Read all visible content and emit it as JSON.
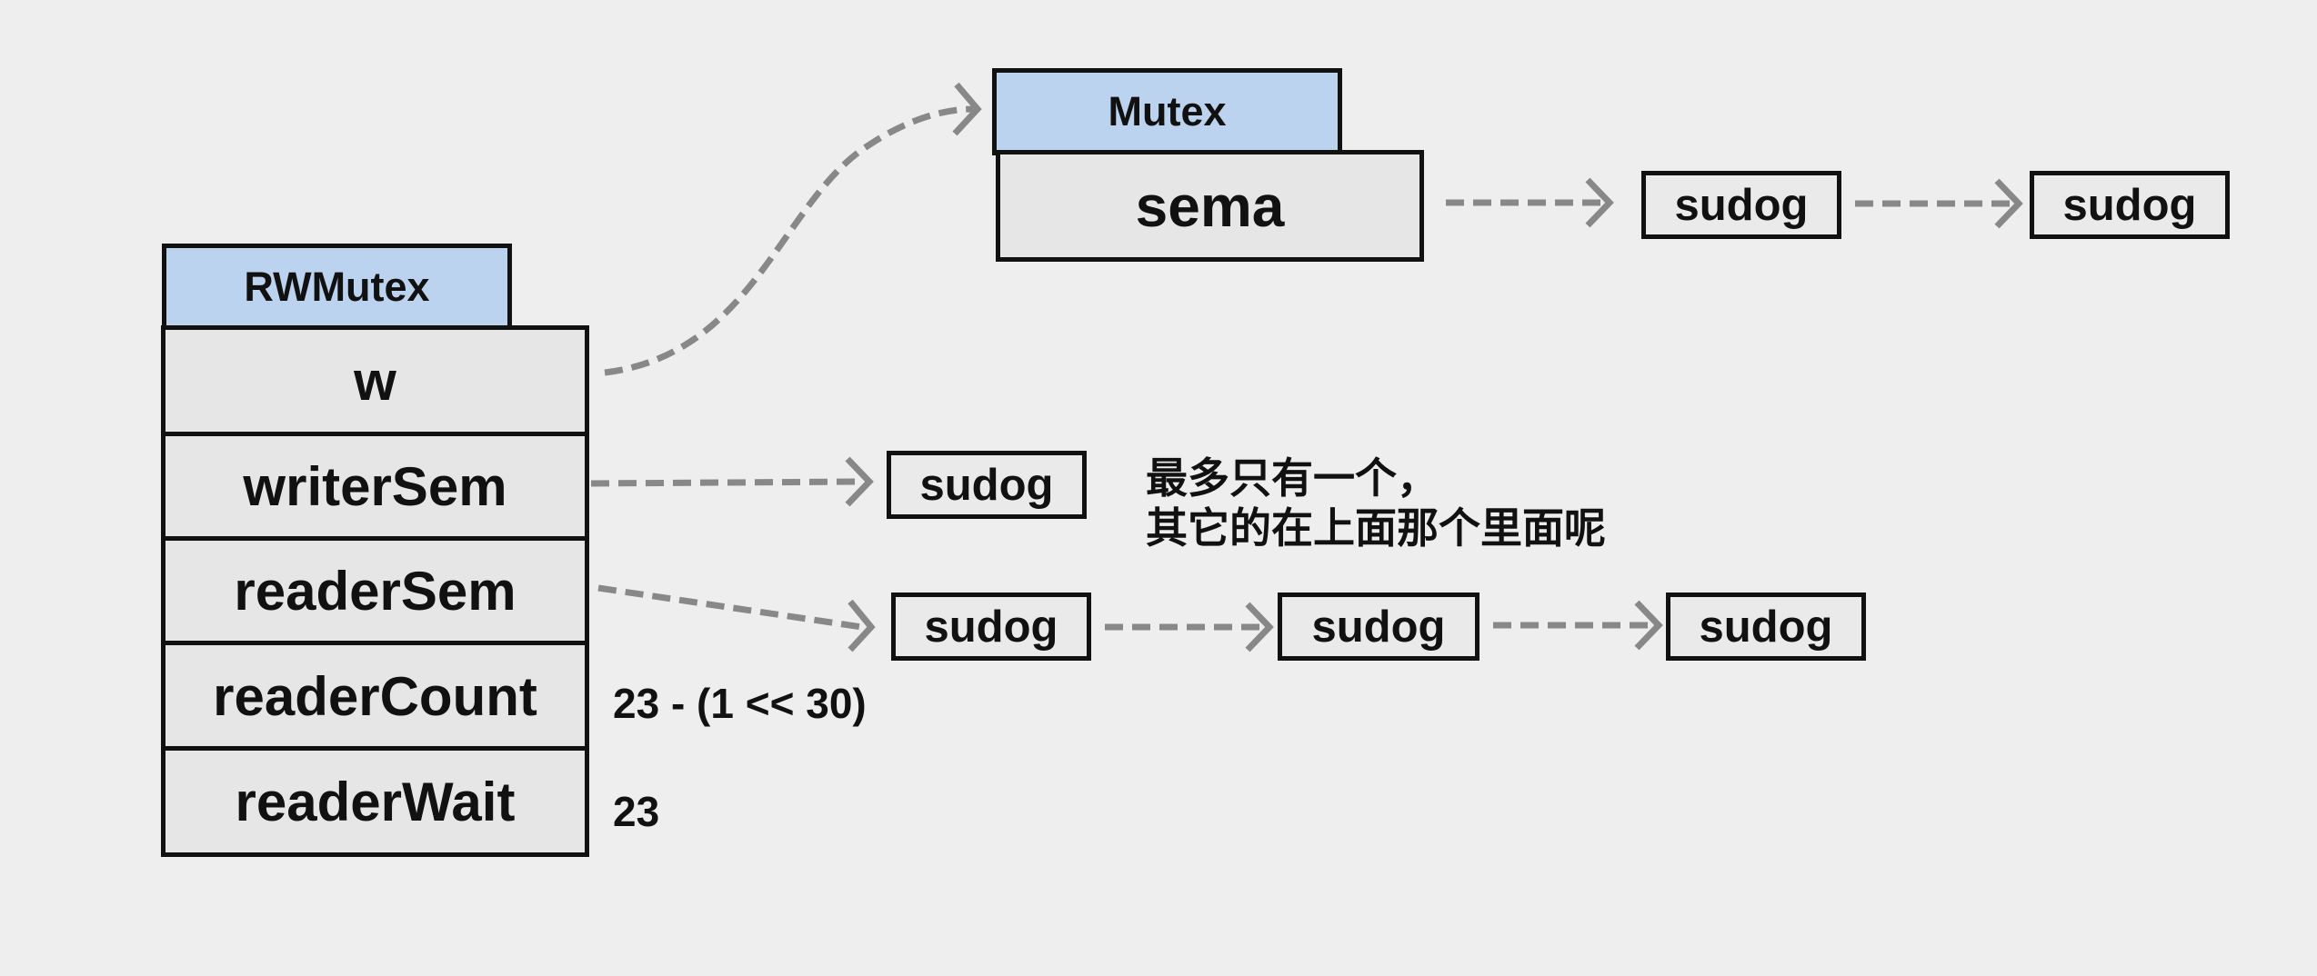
{
  "rwmutex": {
    "title": "RWMutex",
    "fields": [
      "w",
      "writerSem",
      "readerSem",
      "readerCount",
      "readerWait"
    ],
    "readerCount_value": "23 - (1 << 30)",
    "readerWait_value": "23"
  },
  "mutex": {
    "title": "Mutex",
    "field": "sema",
    "queue": [
      "sudog",
      "sudog"
    ]
  },
  "writer_queue": [
    "sudog"
  ],
  "reader_queue": [
    "sudog",
    "sudog",
    "sudog"
  ],
  "writer_note": {
    "line1": "最多只有一个，",
    "line2": "其它的在上面那个里面呢"
  },
  "colors": {
    "header_fill": "#bcd3f0",
    "field_fill": "#e6e6e6",
    "arrow": "#888888",
    "background": "#eeeeee"
  }
}
